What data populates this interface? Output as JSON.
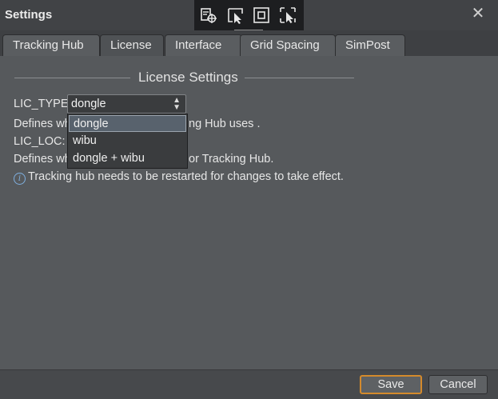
{
  "window": {
    "title": "Settings"
  },
  "tabs": [
    {
      "label": "Tracking Hub",
      "active": false
    },
    {
      "label": "License",
      "active": true
    },
    {
      "label": "Interface",
      "active": false
    },
    {
      "label": "Grid Spacing",
      "active": false
    },
    {
      "label": "SimPost",
      "active": false
    }
  ],
  "section": {
    "title": "License Settings"
  },
  "fields": {
    "lic_type_label": "LIC_TYPE:",
    "lic_type_value": "dongle",
    "lic_type_desc_start": "Defines wh",
    "lic_type_desc_end": "ng Hub uses .",
    "lic_loc_label": "LIC_LOC:",
    "lic_loc_desc_start": "Defines wh",
    "lic_loc_desc_end": "or Tracking Hub."
  },
  "note": {
    "text": "Tracking hub needs to be restarted for changes to take effect."
  },
  "dropdown": {
    "options": [
      "dongle",
      "wibu",
      "dongle + wibu"
    ],
    "selected": "dongle"
  },
  "footer": {
    "save_label": "Save",
    "cancel_label": "Cancel"
  },
  "colors": {
    "accent": "#d48a2c",
    "info": "#7fb0e0"
  }
}
